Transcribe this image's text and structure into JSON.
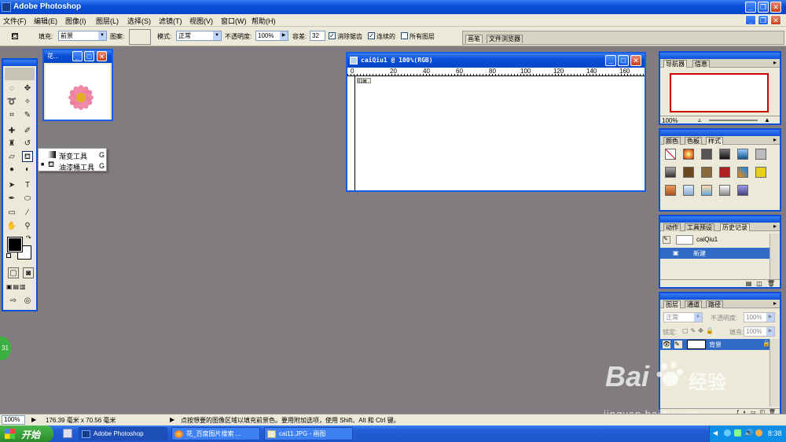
{
  "app": {
    "title": "Adobe Photoshop"
  },
  "menu": [
    "文件(F)",
    "编辑(E)",
    "图像(I)",
    "图层(L)",
    "选择(S)",
    "滤镜(T)",
    "视图(V)",
    "窗口(W)",
    "帮助(H)"
  ],
  "options": {
    "fill_label": "填充:",
    "fill_value": "前景",
    "pattern_label": "图案:",
    "mode_label": "模式:",
    "mode_value": "正常",
    "opacity_label": "不透明度:",
    "opacity_value": "100%",
    "tolerance_label": "容差:",
    "tolerance_value": "32",
    "antialias_label": "消除锯齿",
    "contiguous_label": "连续的",
    "all_layers_label": "所有图层",
    "well_tabs": [
      "画笔",
      "文件浏览器"
    ]
  },
  "flyout": {
    "items": [
      {
        "label": "渐变工具",
        "shortcut": "G"
      },
      {
        "label": "油漆桶工具",
        "shortcut": "G"
      }
    ]
  },
  "thumb_window": {
    "title": "花..."
  },
  "canvas_window": {
    "title": "caiQiu1 @ 100%(RGB)",
    "ruler_ticks": [
      "0",
      "20",
      "40",
      "60",
      "80",
      "100",
      "120",
      "140",
      "160"
    ]
  },
  "navigator": {
    "tabs": [
      "导航器",
      "信息"
    ],
    "zoom": "100%"
  },
  "swatches": {
    "tabs": [
      "颜色",
      "色板",
      "样式"
    ]
  },
  "history": {
    "tabs": [
      "动作",
      "工具预设",
      "历史记录"
    ],
    "snapshot": "caiQiu1",
    "state": "新建"
  },
  "layers": {
    "tabs": [
      "图层",
      "通道",
      "路径"
    ],
    "blend": "正常",
    "opacity_label": "不透明度:",
    "opacity": "100%",
    "lock_label": "锁定:",
    "fill_label": "填充:",
    "fill": "100%",
    "layer_name": "背景"
  },
  "status": {
    "zoom": "100%",
    "doc_size": "176.39 毫米 x 70.56 毫米",
    "hint": "点按想要的图像区域以填充前景色。要用附加选项，使用 Shift、Alt 和 Ctrl 键。"
  },
  "badge": "31",
  "watermark": {
    "brand": "Bai",
    "brand2": "经验",
    "url": "jingyan.baidu.com"
  },
  "taskbar": {
    "start": "开始",
    "tasks": [
      "Adobe Photoshop",
      "花_百度图片搜索 ...",
      "cai11.JPG - 画图"
    ],
    "clock": "8:38"
  }
}
